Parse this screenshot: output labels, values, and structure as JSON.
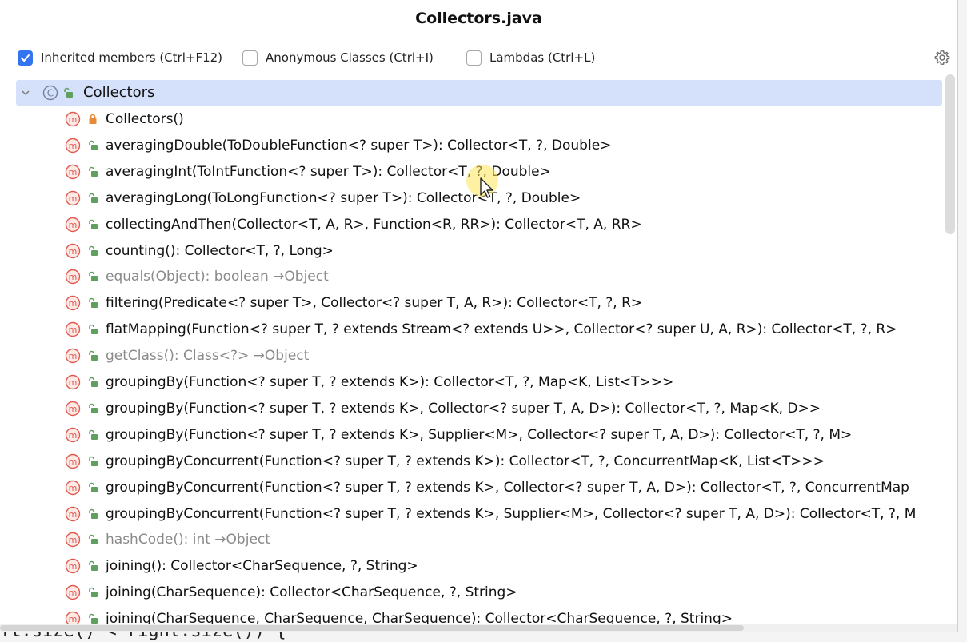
{
  "popup": {
    "title": "Collectors.java"
  },
  "options": [
    {
      "label": "Inherited members (Ctrl+F12)",
      "checked": true
    },
    {
      "label": "Anonymous Classes (Ctrl+I)",
      "checked": false
    },
    {
      "label": "Lambdas (Ctrl+L)",
      "checked": false
    }
  ],
  "settings_icon": "gear-icon",
  "colors": {
    "accent": "#3574f0",
    "selection": "#d5e1fb",
    "method_icon": "#e05a4f",
    "public_icon": "#5fa05f",
    "private_lock": "#e8893a",
    "inherited_text": "#8a8a8a"
  },
  "tree": {
    "root": {
      "label": "Collectors",
      "icon": "class-icon",
      "visibility": "public"
    },
    "members": [
      {
        "label": "Collectors()",
        "visibility": "private",
        "inherited": false
      },
      {
        "label": "averagingDouble(ToDoubleFunction<? super T>): Collector<T, ?, Double>",
        "visibility": "public",
        "inherited": false
      },
      {
        "label": "averagingInt(ToIntFunction<? super T>): Collector<T, ?, Double>",
        "visibility": "public",
        "inherited": false
      },
      {
        "label": "averagingLong(ToLongFunction<? super T>): Collector<T, ?, Double>",
        "visibility": "public",
        "inherited": false
      },
      {
        "label": "collectingAndThen(Collector<T, A, R>, Function<R, RR>): Collector<T, A, RR>",
        "visibility": "public",
        "inherited": false
      },
      {
        "label": "counting(): Collector<T, ?, Long>",
        "visibility": "public",
        "inherited": false
      },
      {
        "label": "equals(Object): boolean →Object",
        "visibility": "public",
        "inherited": true
      },
      {
        "label": "filtering(Predicate<? super T>, Collector<? super T, A, R>): Collector<T, ?, R>",
        "visibility": "public",
        "inherited": false
      },
      {
        "label": "flatMapping(Function<? super T, ? extends Stream<? extends U>>, Collector<? super U, A, R>): Collector<T, ?, R>",
        "visibility": "public",
        "inherited": false
      },
      {
        "label": "getClass(): Class<?> →Object",
        "visibility": "public",
        "inherited": true
      },
      {
        "label": "groupingBy(Function<? super T, ? extends K>): Collector<T, ?, Map<K, List<T>>>",
        "visibility": "public",
        "inherited": false
      },
      {
        "label": "groupingBy(Function<? super T, ? extends K>, Collector<? super T, A, D>): Collector<T, ?, Map<K, D>>",
        "visibility": "public",
        "inherited": false
      },
      {
        "label": "groupingBy(Function<? super T, ? extends K>, Supplier<M>, Collector<? super T, A, D>): Collector<T, ?, M>",
        "visibility": "public",
        "inherited": false
      },
      {
        "label": "groupingByConcurrent(Function<? super T, ? extends K>): Collector<T, ?, ConcurrentMap<K, List<T>>>",
        "visibility": "public",
        "inherited": false
      },
      {
        "label": "groupingByConcurrent(Function<? super T, ? extends K>, Collector<? super T, A, D>): Collector<T, ?, ConcurrentMap",
        "visibility": "public",
        "inherited": false
      },
      {
        "label": "groupingByConcurrent(Function<? super T, ? extends K>, Supplier<M>, Collector<? super T, A, D>): Collector<T, ?, M",
        "visibility": "public",
        "inherited": false
      },
      {
        "label": "hashCode(): int →Object",
        "visibility": "public",
        "inherited": true
      },
      {
        "label": "joining(): Collector<CharSequence, ?, String>",
        "visibility": "public",
        "inherited": false
      },
      {
        "label": "joining(CharSequence): Collector<CharSequence, ?, String>",
        "visibility": "public",
        "inherited": false
      },
      {
        "label": "joining(CharSequence, CharSequence, CharSequence): Collector<CharSequence, ?, String>",
        "visibility": "public",
        "inherited": false
      }
    ]
  },
  "editor_peek": "ft.size() < right.size()) {"
}
